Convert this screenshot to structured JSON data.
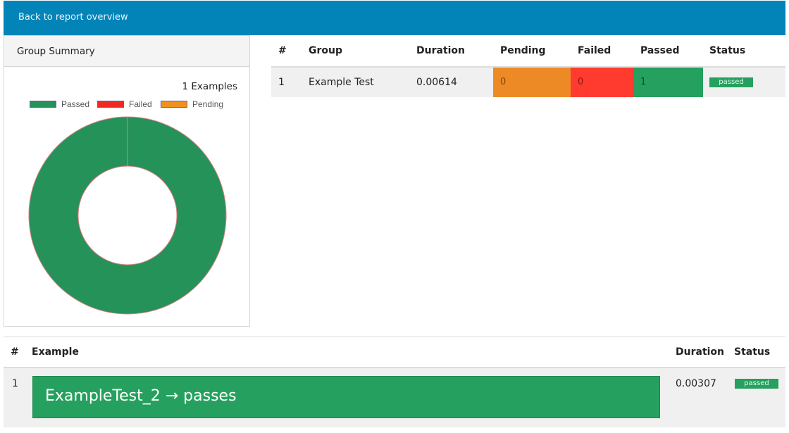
{
  "nav": {
    "back_link": "Back to report overview"
  },
  "summary": {
    "title": "Group Summary",
    "examples_count": "1 Examples",
    "legend": [
      {
        "label": "Passed",
        "color": "#25925a"
      },
      {
        "label": "Failed",
        "color": "#ee2a24"
      },
      {
        "label": "Pending",
        "color": "#f0901e"
      }
    ]
  },
  "chart_data": {
    "type": "pie",
    "title": "",
    "categories": [
      "Passed",
      "Failed",
      "Pending"
    ],
    "values": [
      1,
      0,
      0
    ],
    "colors": [
      "#25925a",
      "#ee2a24",
      "#f0901e"
    ],
    "donut": true
  },
  "group_table": {
    "headers": {
      "num": "#",
      "group": "Group",
      "duration": "Duration",
      "pending": "Pending",
      "failed": "Failed",
      "passed": "Passed",
      "status": "Status"
    },
    "rows": [
      {
        "num": "1",
        "group": "Example Test",
        "duration": "0.00614",
        "pending": "0",
        "failed": "0",
        "passed": "1",
        "status": "passed"
      }
    ]
  },
  "example_table": {
    "headers": {
      "num": "#",
      "example": "Example",
      "duration": "Duration",
      "status": "Status"
    },
    "rows": [
      {
        "num": "1",
        "example": "ExampleTest_2 → passes",
        "duration": "0.00307",
        "status": "passed"
      }
    ]
  },
  "colors": {
    "header_bg": "#0384b8",
    "passed": "#25a05e",
    "failed": "#ff3b30",
    "pending": "#ee8a26"
  }
}
